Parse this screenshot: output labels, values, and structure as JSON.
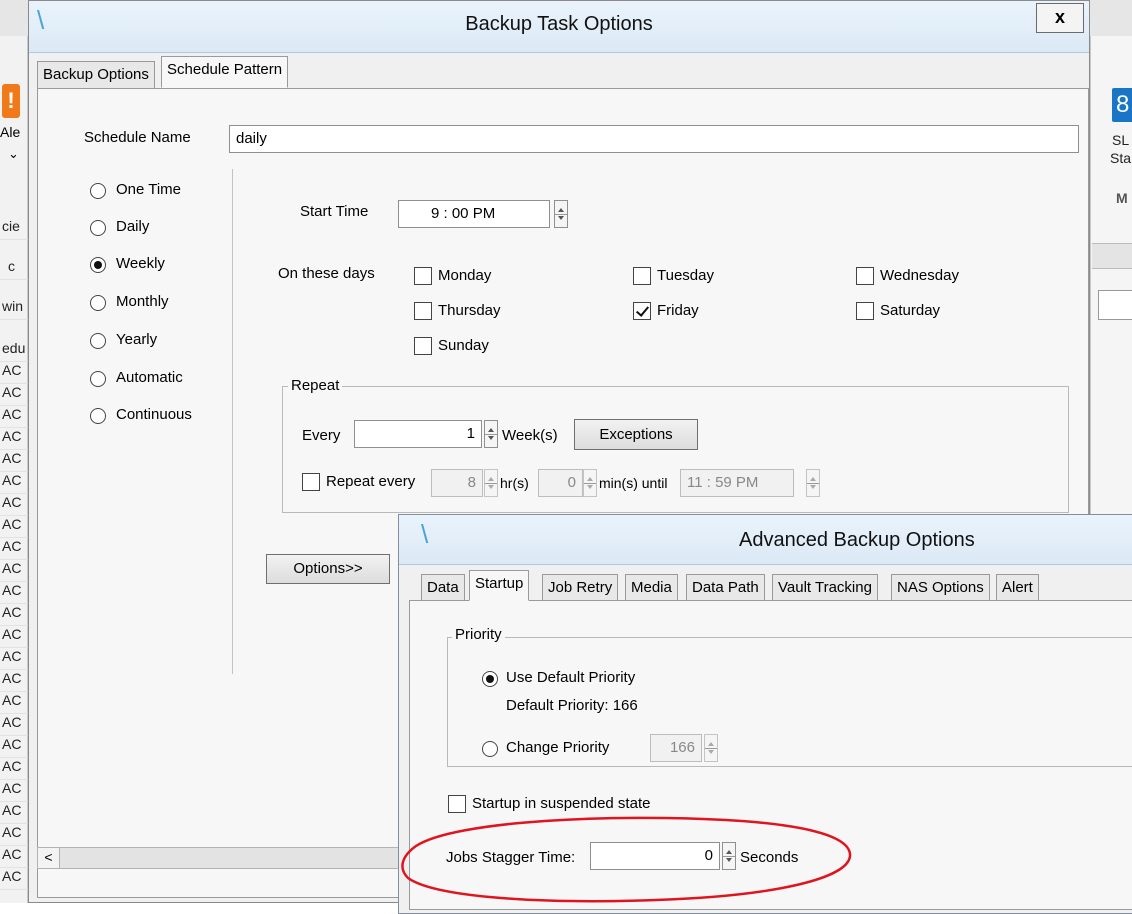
{
  "background_app": {
    "left_fragments": {
      "alert_short": "Ale",
      "row_a": "cie",
      "row_b": "c",
      "row_c": "win",
      "row_d": "edu",
      "repeated": [
        "AC",
        "AC",
        "AC",
        "AC",
        "AC",
        "AC",
        "AC",
        "AC",
        "AC",
        "AC",
        "AC",
        "AC",
        "AC",
        "AC",
        "AC",
        "AC",
        "AC",
        "AC",
        "AC",
        "AC",
        "AC",
        "AC",
        "AC",
        "AC"
      ]
    },
    "right_fragments": {
      "badge": "8",
      "line1": "SL",
      "line2": "Sta",
      "line3": "M"
    }
  },
  "main_dialog": {
    "title": "Backup Task Options",
    "close_label": "x",
    "tabs": [
      {
        "label": "Backup Options",
        "active": false
      },
      {
        "label": "Schedule Pattern",
        "active": true
      }
    ],
    "schedule_name_label": "Schedule Name",
    "schedule_name_value": "daily",
    "frequency_options": [
      {
        "label": "One Time",
        "checked": false
      },
      {
        "label": "Daily",
        "checked": false
      },
      {
        "label": "Weekly",
        "checked": true
      },
      {
        "label": "Monthly",
        "checked": false
      },
      {
        "label": "Yearly",
        "checked": false
      },
      {
        "label": "Automatic",
        "checked": false
      },
      {
        "label": "Continuous",
        "checked": false
      }
    ],
    "start_time_label": "Start Time",
    "start_time_value": "9 : 00 PM",
    "days_label": "On these days",
    "days": [
      {
        "label": "Monday",
        "checked": false
      },
      {
        "label": "Tuesday",
        "checked": false
      },
      {
        "label": "Wednesday",
        "checked": false
      },
      {
        "label": "Thursday",
        "checked": false
      },
      {
        "label": "Friday",
        "checked": true
      },
      {
        "label": "Saturday",
        "checked": false
      },
      {
        "label": "Sunday",
        "checked": false
      }
    ],
    "repeat": {
      "group_label": "Repeat",
      "every_label": "Every",
      "every_value": "1",
      "unit_label": "Week(s)",
      "exceptions_button": "Exceptions",
      "repeat_every_label": "Repeat every",
      "repeat_every_checked": false,
      "hours_value": "8",
      "hours_unit": "hr(s)",
      "minutes_value": "0",
      "minutes_unit": "min(s) until",
      "until_value": "11 : 59 PM"
    },
    "options_button": "Options>>",
    "scroll_left_glyph": "<"
  },
  "advanced_dialog": {
    "title": "Advanced Backup Options",
    "tabs": [
      {
        "label": "Data",
        "active": false
      },
      {
        "label": "Startup",
        "active": true
      },
      {
        "label": "Job Retry",
        "active": false
      },
      {
        "label": "Media",
        "active": false
      },
      {
        "label": "Data Path",
        "active": false
      },
      {
        "label": "Vault Tracking",
        "active": false
      },
      {
        "label": "NAS Options",
        "active": false
      },
      {
        "label": "Alert",
        "active": false
      }
    ],
    "priority_group_label": "Priority",
    "use_default_label": "Use Default Priority",
    "use_default_checked": true,
    "default_priority_text": "Default Priority: 166",
    "change_priority_label": "Change Priority",
    "change_priority_checked": false,
    "change_priority_value": "166",
    "suspended_label": "Startup in suspended state",
    "suspended_checked": false,
    "stagger_label": "Jobs Stagger Time:",
    "stagger_value": "0",
    "stagger_unit": "Seconds"
  },
  "colors": {
    "title_accent": "#4aa3d9",
    "annotation": "#e0141e"
  }
}
